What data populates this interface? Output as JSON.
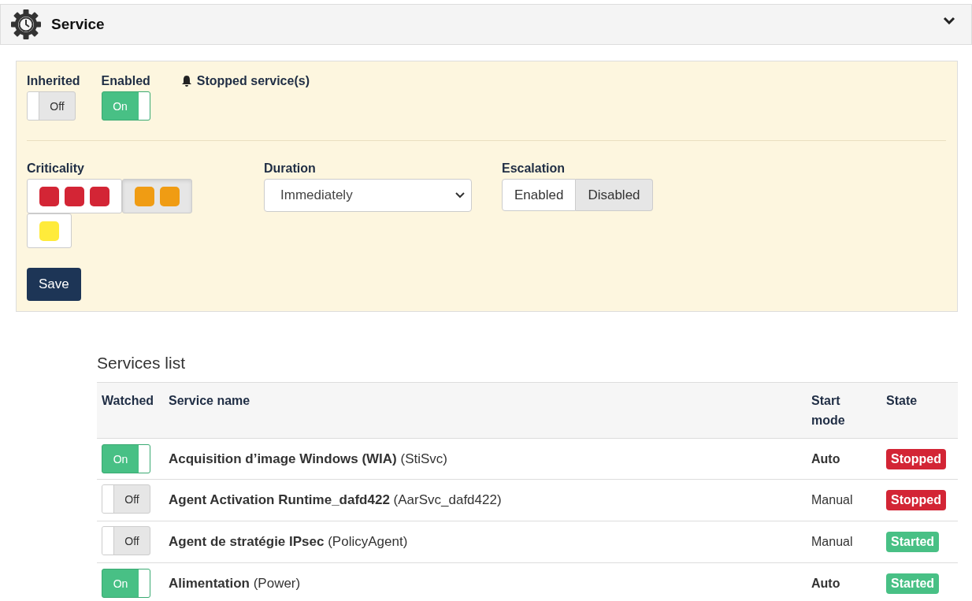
{
  "header": {
    "title": "Service",
    "expanded": true
  },
  "settings": {
    "inherited": {
      "label": "Inherited",
      "on": false,
      "text": "Off"
    },
    "enabled": {
      "label": "Enabled",
      "on": true,
      "text": "On"
    },
    "alert": "Stopped service(s)",
    "criticality": {
      "label": "Criticality",
      "options": [
        {
          "selected": false,
          "squares": [
            {
              "color": "#d32535"
            },
            {
              "color": "#d32535"
            },
            {
              "color": "#d32535"
            }
          ]
        },
        {
          "selected": true,
          "squares": [
            {
              "color": "#f09c13"
            },
            {
              "color": "#f09c13"
            }
          ]
        },
        {
          "selected": false,
          "squares": [
            {
              "color": "#ffeb3b"
            }
          ]
        }
      ]
    },
    "duration": {
      "label": "Duration",
      "value": "Immediately"
    },
    "escalation": {
      "label": "Escalation",
      "options": [
        {
          "label": "Enabled",
          "selected": false
        },
        {
          "label": "Disabled",
          "selected": true
        }
      ]
    },
    "save": "Save"
  },
  "services": {
    "title": "Services list",
    "columns": [
      "Watched",
      "Service name",
      "Start mode",
      "State"
    ],
    "rows": [
      {
        "watched": {
          "on": true,
          "text": "On"
        },
        "name": "**Acquisition d’image Windows (WIA)** (StiSvc)",
        "start_mode": "Auto",
        "start_bold": true,
        "state": {
          "label": "Stopped",
          "kind": "stopped"
        }
      },
      {
        "watched": {
          "on": false,
          "text": "Off"
        },
        "name": "**Agent Activation Runtime_dafd422** (AarSvc_dafd422)",
        "start_mode": "Manual",
        "start_bold": false,
        "state": {
          "label": "Stopped",
          "kind": "stopped"
        }
      },
      {
        "watched": {
          "on": false,
          "text": "Off"
        },
        "name": "**Agent de stratégie IPsec** (PolicyAgent)",
        "start_mode": "Manual",
        "start_bold": false,
        "state": {
          "label": "Started",
          "kind": "started"
        }
      },
      {
        "watched": {
          "on": true,
          "text": "On"
        },
        "name": "**Alimentation** (Power)",
        "start_mode": "Auto",
        "start_bold": true,
        "state": {
          "label": "Started",
          "kind": "started"
        }
      }
    ]
  }
}
